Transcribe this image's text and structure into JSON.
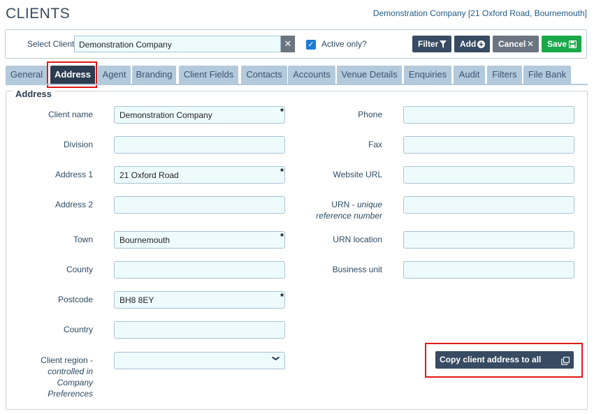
{
  "page": {
    "title": "CLIENTS",
    "current_client_caption": "Demonstration Company [21 Oxford Road, Bournemouth]"
  },
  "toolbar": {
    "select_label": "Select Client",
    "client_value": "Demonstration Company",
    "active_only_label": "Active only?",
    "active_only_checked": true,
    "buttons": {
      "filter": "Filter",
      "add": "Add",
      "cancel": "Cancel",
      "save": "Save"
    }
  },
  "tabs": [
    {
      "label": "General"
    },
    {
      "label": "Address",
      "active": true
    },
    {
      "label": "Agent"
    },
    {
      "label": "Branding"
    },
    {
      "label": "Client Fields"
    },
    {
      "label": "Contacts"
    },
    {
      "label": "Accounts"
    },
    {
      "label": "Venue Details"
    },
    {
      "label": "Enquiries"
    },
    {
      "label": "Audit"
    },
    {
      "label": "Filters"
    },
    {
      "label": "File Bank"
    }
  ],
  "form": {
    "legend": "Address",
    "left": {
      "client_name": {
        "label": "Client name",
        "value": "Demonstration Company",
        "required": "*"
      },
      "division": {
        "label": "Division",
        "value": ""
      },
      "address1": {
        "label": "Address 1",
        "value": "21 Oxford Road",
        "required": "*"
      },
      "address2": {
        "label": "Address 2",
        "value": ""
      },
      "town": {
        "label": "Town",
        "value": "Bournemouth",
        "required": "*"
      },
      "county": {
        "label": "County",
        "value": ""
      },
      "postcode": {
        "label": "Postcode",
        "value": "BH8 8EY",
        "required": "*"
      },
      "country": {
        "label": "Country",
        "value": ""
      },
      "client_region": {
        "label": "Client region -",
        "label_note": "controlled in Company Preferences",
        "value": ""
      }
    },
    "right": {
      "phone": {
        "label": "Phone",
        "value": ""
      },
      "fax": {
        "label": "Fax",
        "value": ""
      },
      "website_url": {
        "label": "Website URL",
        "value": ""
      },
      "urn": {
        "label": "URN -",
        "label_note": "unique reference number",
        "value": ""
      },
      "urn_location": {
        "label": "URN location",
        "value": ""
      },
      "business_unit": {
        "label": "Business unit",
        "value": ""
      }
    },
    "copy_button": "Copy client address to all contacts"
  },
  "colors": {
    "primary": "#374b62",
    "tab_bg": "#b3c9dc",
    "tab_active": "#2d3d51",
    "save_green": "#1ba84a",
    "field_bg": "#eefbfd",
    "highlight_red": "#e01818"
  },
  "icons": {
    "filter": "funnel-icon",
    "add": "plus-circle-icon",
    "cancel": "close-icon",
    "save": "floppy-disk-icon",
    "copy": "copy-icon",
    "select_clear": "close-icon",
    "dropdown": "chevron-down-icon"
  }
}
